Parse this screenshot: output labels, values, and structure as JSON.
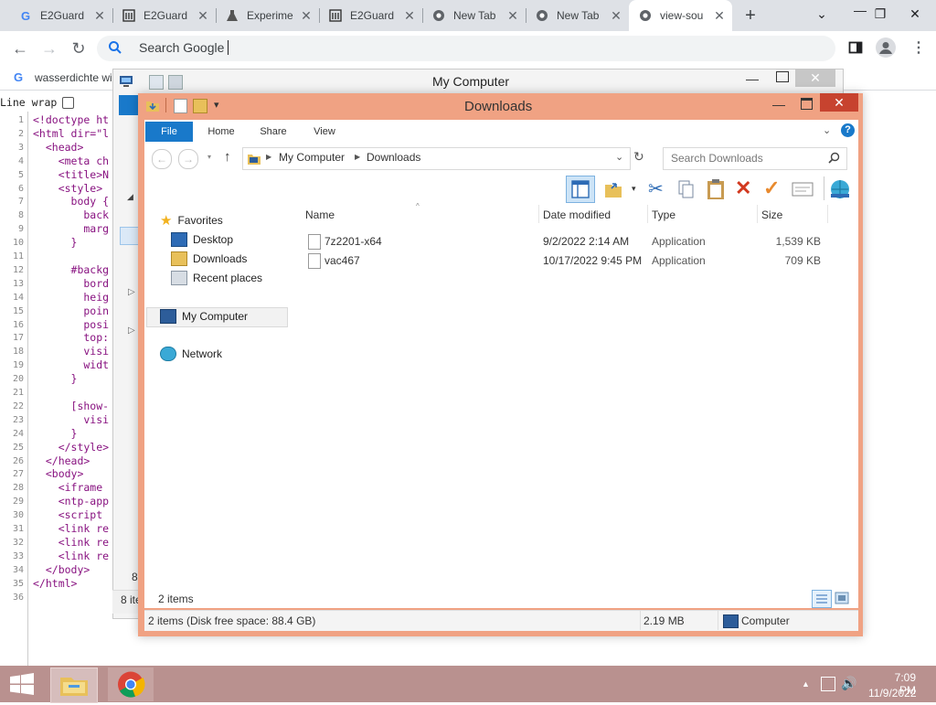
{
  "browser": {
    "tabs": [
      {
        "title": "E2Guard",
        "icon": "google-icon",
        "active": false
      },
      {
        "title": "E2Guard",
        "icon": "institution-icon",
        "active": false
      },
      {
        "title": "Experime",
        "icon": "flask-icon",
        "active": false
      },
      {
        "title": "E2Guard",
        "icon": "institution-icon",
        "active": false
      },
      {
        "title": "New Tab",
        "icon": "chrome-icon",
        "active": false
      },
      {
        "title": "New Tab",
        "icon": "chrome-icon",
        "active": false
      },
      {
        "title": "view-sou",
        "icon": "chrome-icon",
        "active": true
      }
    ],
    "new_tab": "+",
    "omnibox_placeholder": "Search Google",
    "bookmark_label": "wasserdichte wi",
    "line_wrap_label": "Line wrap"
  },
  "source": {
    "lines": [
      {
        "n": "1",
        "code": "<!doctype ht"
      },
      {
        "n": "2",
        "code": "<html dir=\"l"
      },
      {
        "n": "3",
        "code": "  <head>"
      },
      {
        "n": "4",
        "code": "    <meta ch"
      },
      {
        "n": "5",
        "code": "    <title>N"
      },
      {
        "n": "6",
        "code": "    <style>"
      },
      {
        "n": "7",
        "code": "      body {"
      },
      {
        "n": "8",
        "code": "        back"
      },
      {
        "n": "9",
        "code": "        marg"
      },
      {
        "n": "10",
        "code": "      }"
      },
      {
        "n": "11",
        "code": ""
      },
      {
        "n": "12",
        "code": "      #backg"
      },
      {
        "n": "13",
        "code": "        bord"
      },
      {
        "n": "14",
        "code": "        heig"
      },
      {
        "n": "15",
        "code": "        poin"
      },
      {
        "n": "16",
        "code": "        posi"
      },
      {
        "n": "17",
        "code": "        top:"
      },
      {
        "n": "18",
        "code": "        visi"
      },
      {
        "n": "19",
        "code": "        widt"
      },
      {
        "n": "20",
        "code": "      }"
      },
      {
        "n": "21",
        "code": ""
      },
      {
        "n": "22",
        "code": "      [show-"
      },
      {
        "n": "23",
        "code": "        visi"
      },
      {
        "n": "24",
        "code": "      }"
      },
      {
        "n": "25",
        "code": "    </style>"
      },
      {
        "n": "26",
        "code": "  </head>"
      },
      {
        "n": "27",
        "code": "  <body>"
      },
      {
        "n": "28",
        "code": "    <iframe"
      },
      {
        "n": "29",
        "code": "    <ntp-app"
      },
      {
        "n": "30",
        "code": "    <script"
      },
      {
        "n": "31",
        "code": "    <link re"
      },
      {
        "n": "32",
        "code": "    <link re"
      },
      {
        "n": "33",
        "code": "    <link re"
      },
      {
        "n": "34",
        "code": "  </body>"
      },
      {
        "n": "35",
        "code": "</html>"
      },
      {
        "n": "36",
        "code": ""
      }
    ]
  },
  "bg_window": {
    "title": "My Computer",
    "status_count": "8 ite",
    "side_count": "8"
  },
  "explorer": {
    "title": "Downloads",
    "ribbon_tabs": [
      "File",
      "Home",
      "Share",
      "View"
    ],
    "breadcrumb": [
      "My Computer",
      "Downloads"
    ],
    "search_placeholder": "Search Downloads",
    "columns": {
      "name": "Name",
      "date": "Date modified",
      "type": "Type",
      "size": "Size"
    },
    "files": [
      {
        "name": "7z2201-x64",
        "date": "9/2/2022 2:14 AM",
        "type": "Application",
        "size": "1,539 KB"
      },
      {
        "name": "vac467",
        "date": "10/17/2022 9:45 PM",
        "type": "Application",
        "size": "709 KB"
      }
    ],
    "nav": {
      "favorites": "Favorites",
      "desktop": "Desktop",
      "downloads": "Downloads",
      "recent": "Recent places",
      "computer": "My Computer",
      "network": "Network"
    },
    "item_count": "2 items",
    "status_main": "2 items (Disk free space: 88.4 GB)",
    "status_size": "2.19 MB",
    "status_location": "Computer"
  },
  "taskbar": {
    "time": "7:09 PM",
    "date": "11/9/2022"
  },
  "colors": {
    "explorer_frame": "#f0a283",
    "file_tab": "#1979ca",
    "taskbar": "#b9918f",
    "tabstrip": "#dee1e6"
  }
}
